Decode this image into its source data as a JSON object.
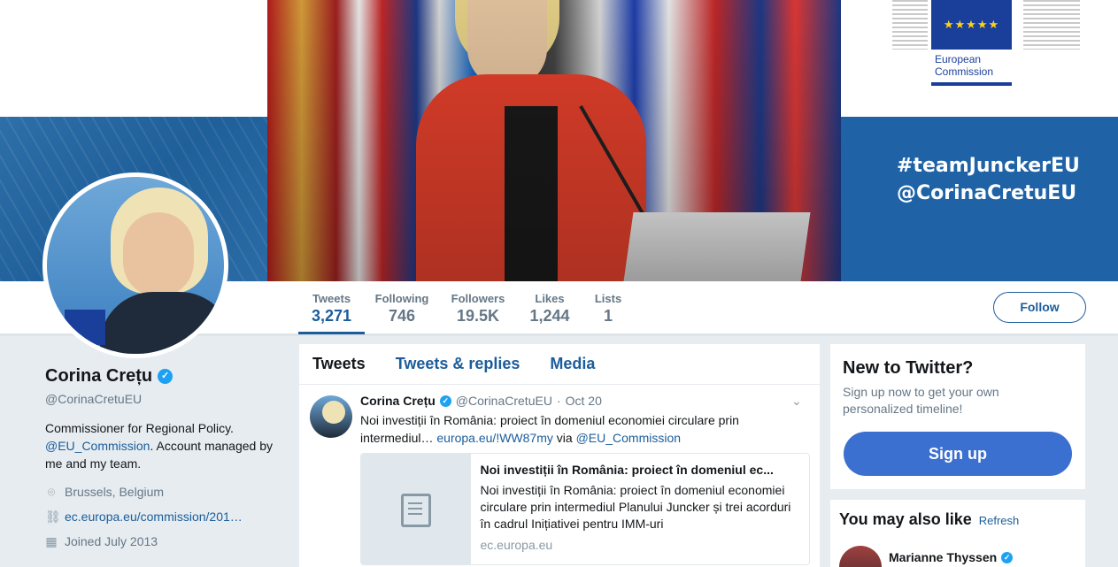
{
  "banner": {
    "ec_logo_text_line1": "European",
    "ec_logo_text_line2": "Commission",
    "hashtag_line1": "#teamJunckerEU",
    "hashtag_line2": "@CorinaCretuEU"
  },
  "nav": {
    "stats": [
      {
        "label": "Tweets",
        "value": "3,271"
      },
      {
        "label": "Following",
        "value": "746"
      },
      {
        "label": "Followers",
        "value": "19.5K"
      },
      {
        "label": "Likes",
        "value": "1,244"
      },
      {
        "label": "Lists",
        "value": "1"
      }
    ],
    "follow_label": "Follow"
  },
  "profile": {
    "name": "Corina Crețu",
    "handle": "@CorinaCretuEU",
    "bio_part1": "Commissioner for Regional Policy.",
    "bio_link": "@EU_Commission",
    "bio_part2": ". Account managed by me and my team.",
    "location": "Brussels, Belgium",
    "website": "ec.europa.eu/commission/201…",
    "joined": "Joined July 2013"
  },
  "timeline": {
    "tabs": [
      "Tweets",
      "Tweets & replies",
      "Media"
    ],
    "tweet": {
      "author": "Corina Crețu",
      "handle": "@CorinaCretuEU",
      "separator": "·",
      "date": "Oct 20",
      "text_part1": "Noi investiții în România: proiect în domeniul economiei circulare prin intermediul…",
      "text_link": "europa.eu/!WW87my",
      "text_via": "via",
      "text_mention": "@EU_Commission",
      "card": {
        "title": "Noi investiții în România: proiect în domeniul ec...",
        "description": "Noi investiții în România: proiect în domeniul economiei circulare prin intermediul Planului Juncker și trei acorduri în cadrul Inițiativei pentru IMM-uri",
        "domain": "ec.europa.eu"
      }
    }
  },
  "sidebar": {
    "signup": {
      "title": "New to Twitter?",
      "description": "Sign up now to get your own personalized timeline!",
      "button": "Sign up"
    },
    "wtf": {
      "title": "You may also like",
      "refresh": "Refresh",
      "user_name": "Marianne Thyssen"
    }
  },
  "colors": {
    "accent": "#1b5d9b",
    "verified": "#1da1f2",
    "signup_button": "#3b6fd0"
  }
}
